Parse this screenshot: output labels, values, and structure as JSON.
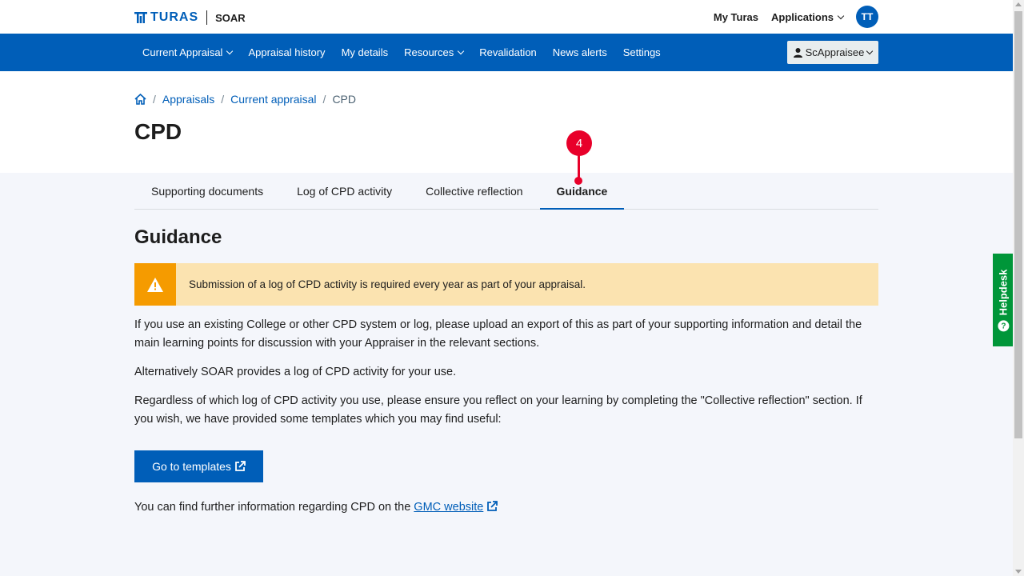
{
  "header": {
    "logo_text": "TURAS",
    "app_name": "SOAR",
    "my_turas": "My Turas",
    "applications": "Applications",
    "avatar_initials": "TT"
  },
  "nav": {
    "items": [
      {
        "label": "Current Appraisal",
        "dropdown": true
      },
      {
        "label": "Appraisal history",
        "dropdown": false
      },
      {
        "label": "My details",
        "dropdown": false
      },
      {
        "label": "Resources",
        "dropdown": true
      },
      {
        "label": "Revalidation",
        "dropdown": false
      },
      {
        "label": "News alerts",
        "dropdown": false
      },
      {
        "label": "Settings",
        "dropdown": false
      }
    ],
    "user_menu": "ScAppraisee"
  },
  "breadcrumb": {
    "home_icon": "home-icon",
    "items": [
      "Appraisals",
      "Current appraisal"
    ],
    "current": "CPD"
  },
  "page_title": "CPD",
  "marker": {
    "number": "4"
  },
  "tabs": [
    {
      "label": "Supporting documents",
      "active": false
    },
    {
      "label": "Log of CPD activity",
      "active": false
    },
    {
      "label": "Collective reflection",
      "active": false
    },
    {
      "label": "Guidance",
      "active": true
    }
  ],
  "content": {
    "title": "Guidance",
    "alert": "Submission of a log of CPD activity is required every year as part of your appraisal.",
    "para1": "If you use an existing College or other CPD system or log, please upload an export of this as part of your supporting information and detail the main learning points for discussion with your Appraiser in the relevant sections.",
    "para2": "Alternatively SOAR provides a log of CPD activity for your use.",
    "para3": "Regardless of which log of CPD activity you use, please ensure you reflect on your learning by completing the \"Collective reflection\" section. If you wish, we have provided some templates which you may find useful:",
    "button": "Go to templates",
    "footer_prefix": "You can find further information regarding CPD on the ",
    "footer_link": "GMC website"
  },
  "helpdesk": "Helpdesk",
  "colors": {
    "brand_blue": "#005eb8",
    "alert_bg": "#fbe3b0",
    "alert_icon_bg": "#f59b00",
    "helpdesk_green": "#009639",
    "marker_red": "#e8002a"
  }
}
